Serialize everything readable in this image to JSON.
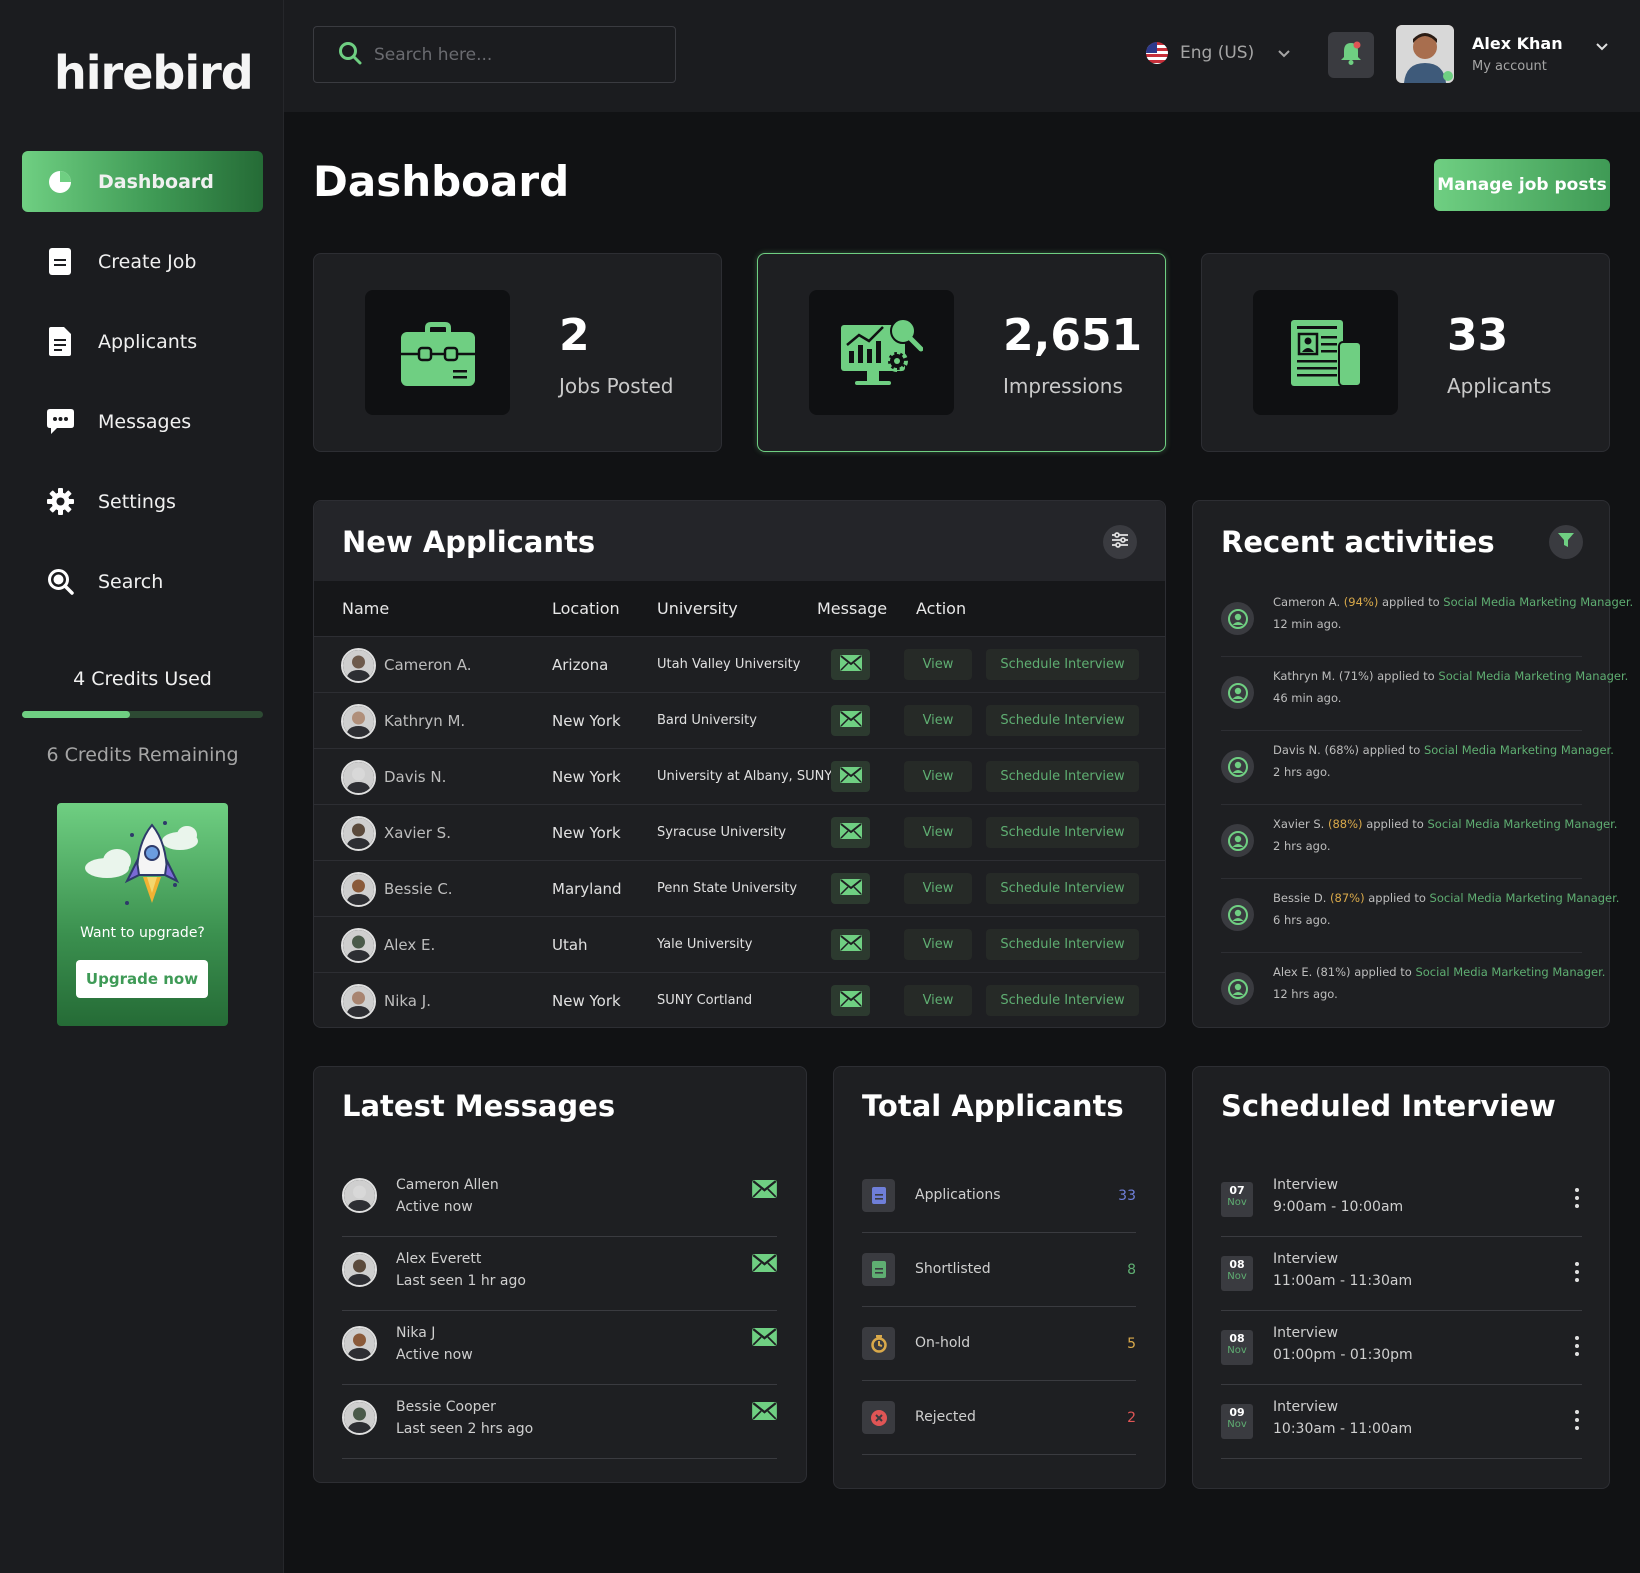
{
  "brand": {
    "logo": "hirebird",
    "accent": "#6fcf82"
  },
  "sidebar": {
    "items": [
      {
        "label": "Dashboard",
        "icon": "pie-chart-icon",
        "active": true
      },
      {
        "label": "Create Job",
        "icon": "document-icon"
      },
      {
        "label": "Applicants",
        "icon": "file-list-icon"
      },
      {
        "label": "Messages",
        "icon": "chat-bubble-icon"
      },
      {
        "label": "Settings",
        "icon": "gear-icon"
      },
      {
        "label": "Search",
        "icon": "search-icon"
      }
    ],
    "credits_used": "4 Credits Used",
    "credits_remaining": "6 Credits Remaining",
    "credit_progress": 0.45,
    "upgrade": {
      "text": "Want to upgrade?",
      "button": "Upgrade now"
    }
  },
  "topbar": {
    "search_placeholder": "Search here...",
    "language": "Eng (US)",
    "user": {
      "name": "Alex Khan",
      "subtitle": "My account"
    }
  },
  "page": {
    "title": "Dashboard",
    "manage_button": "Manage job posts"
  },
  "stats": [
    {
      "value": "2",
      "label": "Jobs Posted",
      "icon": "briefcase-icon"
    },
    {
      "value": "2,651",
      "label": "Impressions",
      "icon": "analytics-monitor-icon"
    },
    {
      "value": "33",
      "label": "Applicants",
      "icon": "resume-icon"
    }
  ],
  "applicants": {
    "title": "New Applicants",
    "columns": [
      "Name",
      "Location",
      "University",
      "Message",
      "Action"
    ],
    "view_label": "View",
    "schedule_label": "Schedule Interview",
    "rows": [
      {
        "name": "Cameron A.",
        "location": "Arizona",
        "university": "Utah Valley University"
      },
      {
        "name": "Kathryn M.",
        "location": "New York",
        "university": "Bard University"
      },
      {
        "name": "Davis N.",
        "location": "New York",
        "university": "University at Albany, SUNY"
      },
      {
        "name": "Xavier S.",
        "location": "New York",
        "university": "Syracuse University"
      },
      {
        "name": "Bessie C.",
        "location": "Maryland",
        "university": "Penn State University"
      },
      {
        "name": "Alex E.",
        "location": "Utah",
        "university": "Yale University"
      },
      {
        "name": "Nika J.",
        "location": "New York",
        "university": "SUNY Cortland"
      }
    ]
  },
  "activities": {
    "title": "Recent activities",
    "applied_text": "applied to",
    "items": [
      {
        "name": "Cameron A.",
        "score": "(94%)",
        "job": "Social Media Marketing Manager.",
        "time": "12 min ago.",
        "score_highlight": true
      },
      {
        "name": "Kathryn M.",
        "score": "(71%)",
        "job": "Social Media Marketing Manager.",
        "time": "46 min ago.",
        "score_highlight": false
      },
      {
        "name": "Davis N.",
        "score": "(68%)",
        "job": "Social Media Marketing Manager.",
        "time": "2 hrs ago.",
        "score_highlight": false
      },
      {
        "name": "Xavier S.",
        "score": "(88%)",
        "job": "Social Media Marketing Manager.",
        "time": "2 hrs ago.",
        "score_highlight": true
      },
      {
        "name": "Bessie D.",
        "score": "(87%)",
        "job": "Social Media Marketing Manager.",
        "time": "6 hrs ago.",
        "score_highlight": true
      },
      {
        "name": "Alex E.",
        "score": "(81%)",
        "job": "Social Media Marketing Manager.",
        "time": "12 hrs ago.",
        "score_highlight": false
      }
    ]
  },
  "messages": {
    "title": "Latest Messages",
    "items": [
      {
        "name": "Cameron Allen",
        "status": "Active now"
      },
      {
        "name": "Alex Everett",
        "status": "Last seen 1 hr ago"
      },
      {
        "name": "Nika J",
        "status": "Active now"
      },
      {
        "name": "Bessie Cooper",
        "status": "Last seen 2 hrs ago"
      }
    ]
  },
  "totals": {
    "title": "Total Applicants",
    "items": [
      {
        "label": "Applications",
        "value": "33",
        "color": "#6f7fd9",
        "icon": "document-icon"
      },
      {
        "label": "Shortlisted",
        "value": "8",
        "color": "#5fae72",
        "icon": "document-icon"
      },
      {
        "label": "On-hold",
        "value": "5",
        "color": "#d9a94a",
        "icon": "hourglass-icon"
      },
      {
        "label": "Rejected",
        "value": "2",
        "color": "#e05555",
        "icon": "reject-icon"
      }
    ]
  },
  "interviews": {
    "title": "Scheduled Interview",
    "items": [
      {
        "day": "07",
        "month": "Nov",
        "label": "Interview",
        "time": "9:00am - 10:00am"
      },
      {
        "day": "08",
        "month": "Nov",
        "label": "Interview",
        "time": "11:00am - 11:30am"
      },
      {
        "day": "08",
        "month": "Nov",
        "label": "Interview",
        "time": "01:00pm - 01:30pm"
      },
      {
        "day": "09",
        "month": "Nov",
        "label": "Interview",
        "time": "10:30am - 11:00am"
      }
    ]
  }
}
